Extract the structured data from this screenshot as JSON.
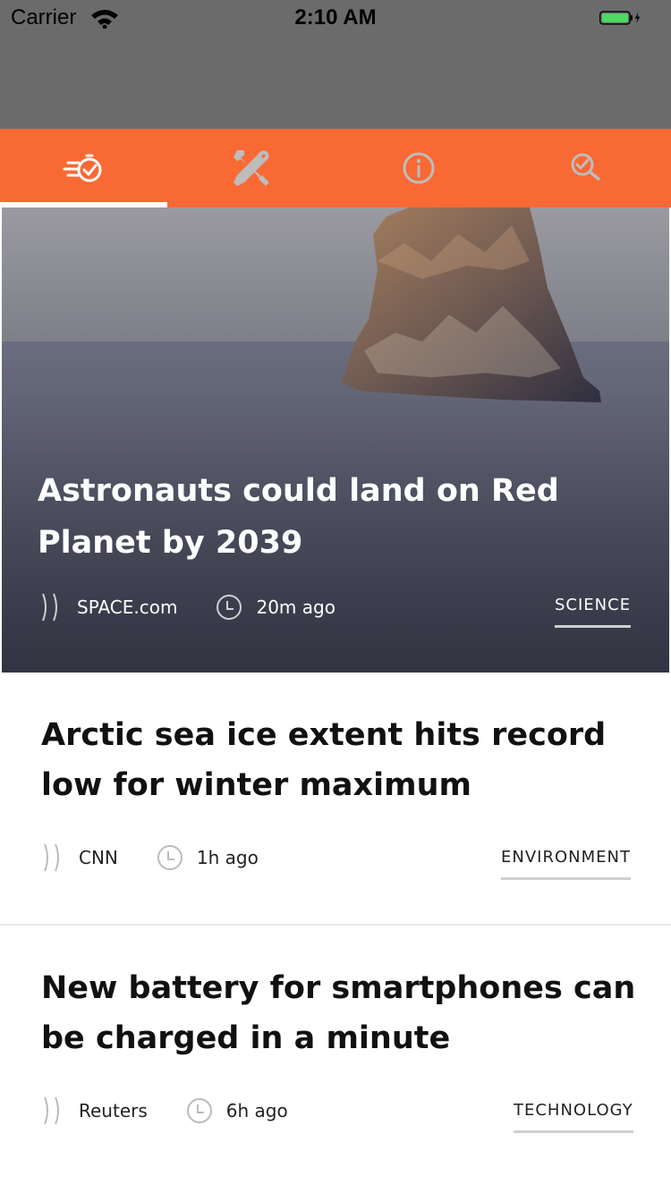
{
  "status": {
    "carrier": "Carrier",
    "time": "2:10 AM"
  },
  "tabs": [
    {
      "icon": "speed-check-icon",
      "active": true
    },
    {
      "icon": "tools-icon",
      "active": false
    },
    {
      "icon": "info-icon",
      "active": false
    },
    {
      "icon": "search-check-icon",
      "active": false
    }
  ],
  "colors": {
    "accent": "#f96934",
    "header": "#6b6b6b"
  },
  "hero": {
    "title": "Astronauts could land on Red Planet by 2039",
    "source": "SPACE.com",
    "time": "20m ago",
    "category": "SCIENCE"
  },
  "articles": [
    {
      "title": "Arctic sea ice extent hits record low for winter maximum",
      "source": "CNN",
      "time": "1h ago",
      "category": "ENVIRONMENT"
    },
    {
      "title": "New battery for smartphones can be charged in a minute",
      "source": "Reuters",
      "time": "6h ago",
      "category": "TECHNOLOGY"
    }
  ]
}
